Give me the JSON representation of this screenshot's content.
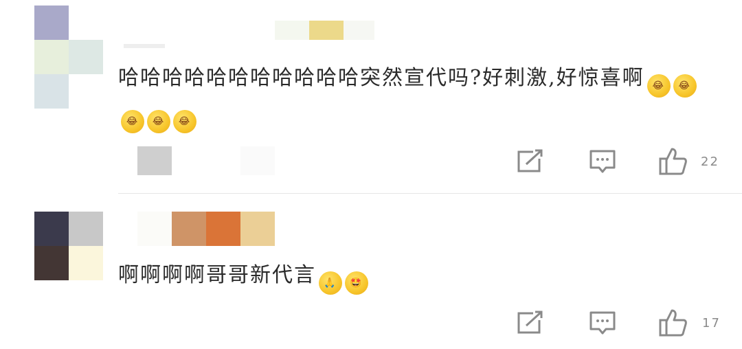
{
  "comments": [
    {
      "text": "哈哈哈哈哈哈哈哈哈哈哈突然宣代吗?好刺激,好惊喜啊",
      "emojis": [
        "laugh-crying",
        "laugh-crying",
        "laugh-crying",
        "laugh-crying",
        "laugh-crying"
      ],
      "like_count": "22"
    },
    {
      "text": "啊啊啊啊哥哥新代言",
      "emojis": [
        "praying",
        "starstruck"
      ],
      "like_count": "17"
    }
  ],
  "colors": {
    "icon": "#8a8a8a",
    "divider": "#e6e6e6",
    "text": "#2a2a2a"
  },
  "icons": [
    "share-icon",
    "comment-icon",
    "like-icon"
  ]
}
